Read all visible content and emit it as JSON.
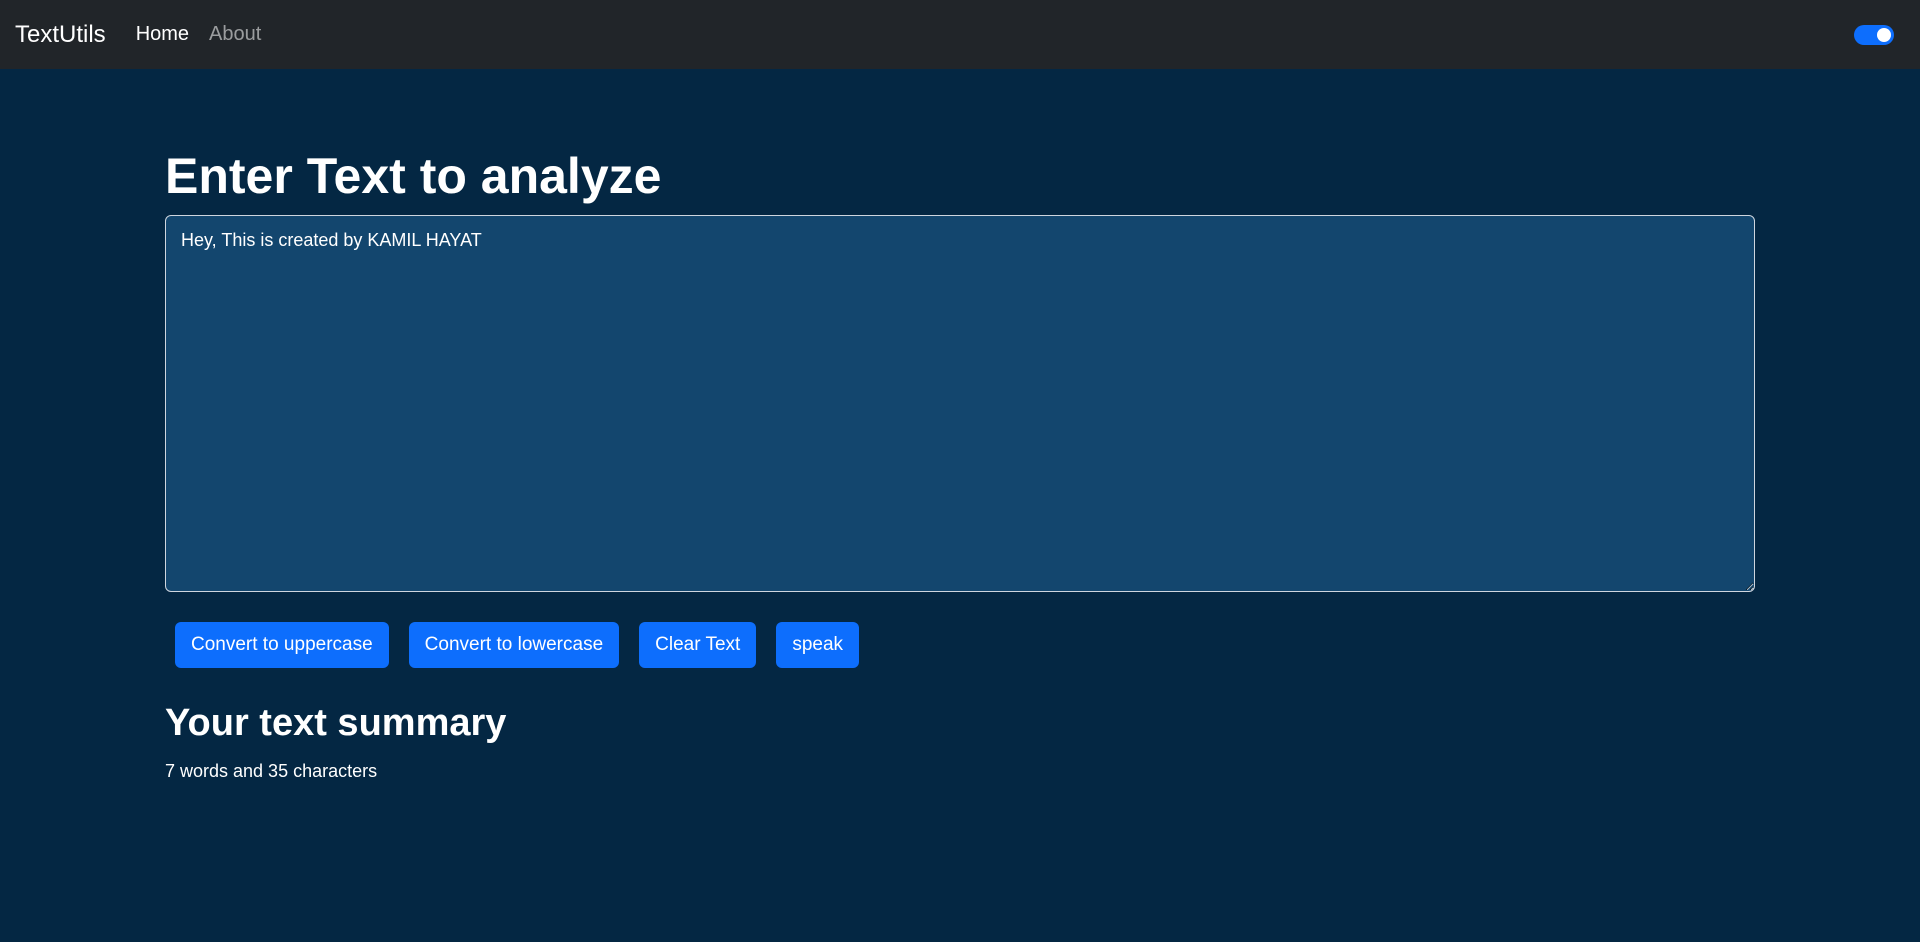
{
  "navbar": {
    "brand": "TextUtils",
    "links": [
      {
        "label": "Home",
        "active": true
      },
      {
        "label": "About",
        "active": false
      }
    ],
    "dark_mode_toggle_on": true
  },
  "main": {
    "heading": "Enter Text to analyze",
    "textarea_value": "Hey, This is created by KAMIL HAYAT",
    "buttons": {
      "uppercase": "Convert to uppercase",
      "lowercase": "Convert to lowercase",
      "clear": "Clear Text",
      "speak": "speak"
    },
    "summary_heading": "Your text summary",
    "summary_text": "7 words and 35 characters"
  },
  "colors": {
    "page_background": "#042743",
    "navbar_background": "#212529",
    "textarea_background": "#13466e",
    "accent": "#0d6efd"
  }
}
